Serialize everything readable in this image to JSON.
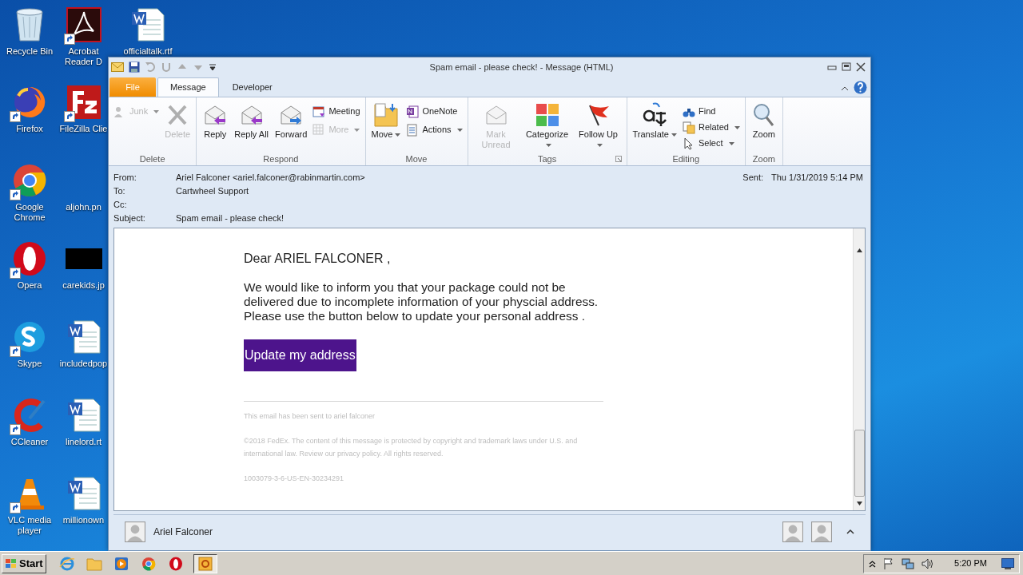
{
  "desktop_icons": [
    {
      "label": "Recycle Bin",
      "shortcut": false
    },
    {
      "label": "Acrobat Reader D",
      "shortcut": true
    },
    {
      "label": "officialtalk.rtf",
      "shortcut": false
    },
    {
      "label": "Firefox",
      "shortcut": true
    },
    {
      "label": "FileZilla Clie",
      "shortcut": true
    },
    {
      "label": "Google Chrome",
      "shortcut": true
    },
    {
      "label": "aljohn.pn"
    },
    {
      "label": "Opera",
      "shortcut": true
    },
    {
      "label": "carekids.jp",
      "shortcut": false
    },
    {
      "label": "Skype",
      "shortcut": true
    },
    {
      "label": "includedpop",
      "shortcut": false
    },
    {
      "label": "CCleaner",
      "shortcut": true
    },
    {
      "label": "linelord.rt",
      "shortcut": false
    },
    {
      "label": "VLC media player",
      "shortcut": true
    },
    {
      "label": "millionown",
      "shortcut": false
    }
  ],
  "window": {
    "title": "Spam email - please check! - Message (HTML)"
  },
  "tabs": [
    {
      "label": "File",
      "kind": "file",
      "selected": false
    },
    {
      "label": "Message",
      "kind": "tab",
      "selected": true
    },
    {
      "label": "Developer",
      "kind": "tab",
      "selected": false
    }
  ],
  "ribbon_groups": [
    {
      "label": "Delete",
      "launcher": false,
      "items": [
        {
          "label": "Junk",
          "kind": "small",
          "disabled": true,
          "dropdown": true
        },
        {
          "label": "Delete",
          "kind": "large",
          "disabled": true,
          "dropdown": false
        }
      ]
    },
    {
      "label": "Respond",
      "launcher": false,
      "items": [
        {
          "label": "Reply",
          "kind": "large",
          "disabled": false,
          "dropdown": false
        },
        {
          "label": "Reply All",
          "kind": "large",
          "disabled": false,
          "dropdown": false
        },
        {
          "label": "Forward",
          "kind": "large",
          "disabled": false,
          "dropdown": false
        },
        {
          "label": "Meeting",
          "kind": "small",
          "disabled": false,
          "dropdown": false
        },
        {
          "label": "More",
          "kind": "small",
          "disabled": true,
          "dropdown": true
        }
      ]
    },
    {
      "label": "Move",
      "launcher": false,
      "items": [
        {
          "label": "Move",
          "kind": "large",
          "disabled": false,
          "dropdown": true
        },
        {
          "label": "OneNote",
          "kind": "small",
          "disabled": false,
          "dropdown": false
        },
        {
          "label": "Actions",
          "kind": "small",
          "disabled": false,
          "dropdown": true
        }
      ]
    },
    {
      "label": "Tags",
      "launcher": true,
      "items": [
        {
          "label": "Mark Unread",
          "kind": "large",
          "disabled": true,
          "dropdown": false
        },
        {
          "label": "Categorize",
          "kind": "large",
          "disabled": false,
          "dropdown": true
        },
        {
          "label": "Follow Up",
          "kind": "large",
          "disabled": false,
          "dropdown": true
        }
      ]
    },
    {
      "label": "Editing",
      "launcher": false,
      "items": [
        {
          "label": "Translate",
          "kind": "large",
          "disabled": false,
          "dropdown": true
        },
        {
          "label": "Find",
          "kind": "small",
          "disabled": false,
          "dropdown": false
        },
        {
          "label": "Related",
          "kind": "small",
          "disabled": false,
          "dropdown": true
        },
        {
          "label": "Select",
          "kind": "small",
          "disabled": false,
          "dropdown": true
        }
      ]
    },
    {
      "label": "Zoom",
      "launcher": false,
      "items": [
        {
          "label": "Zoom",
          "kind": "large",
          "disabled": false,
          "dropdown": false
        }
      ]
    }
  ],
  "header": {
    "fields": [
      {
        "label": "From:",
        "value": "Ariel Falconer <ariel.falconer@rabinmartin.com>"
      },
      {
        "label": "To:",
        "value": "Cartwheel Support"
      },
      {
        "label": "Cc:"
      },
      {
        "label": "Subject:",
        "value": "Spam email - please check!"
      }
    ],
    "sent": {
      "label": "Sent:",
      "value": "Thu 1/31/2019 5:14 PM"
    }
  },
  "message": {
    "greeting": "Dear ARIEL FALCONER ,",
    "paragraph": "We would like to inform you that your package could not be delivered due to incomplete information of your physcial address. Please use the button below to update your personal address .",
    "button": "Update my address",
    "footer": [
      "This email has been sent to ariel falconer",
      "©2018 FedEx. The content of this message is protected by copyright and trademark laws under U.S. and international law. Review our privacy policy. All rights reserved.",
      "1003079-3-6-US-EN-30234291"
    ]
  },
  "people_pane": {
    "name": "Ariel Falconer"
  },
  "taskbar": {
    "start": "Start",
    "apps": [
      {
        "selected": false
      },
      {
        "selected": false
      },
      {
        "selected": false
      },
      {
        "selected": false
      },
      {
        "selected": false
      },
      {
        "selected": true
      }
    ],
    "clock": "5:20 PM"
  }
}
